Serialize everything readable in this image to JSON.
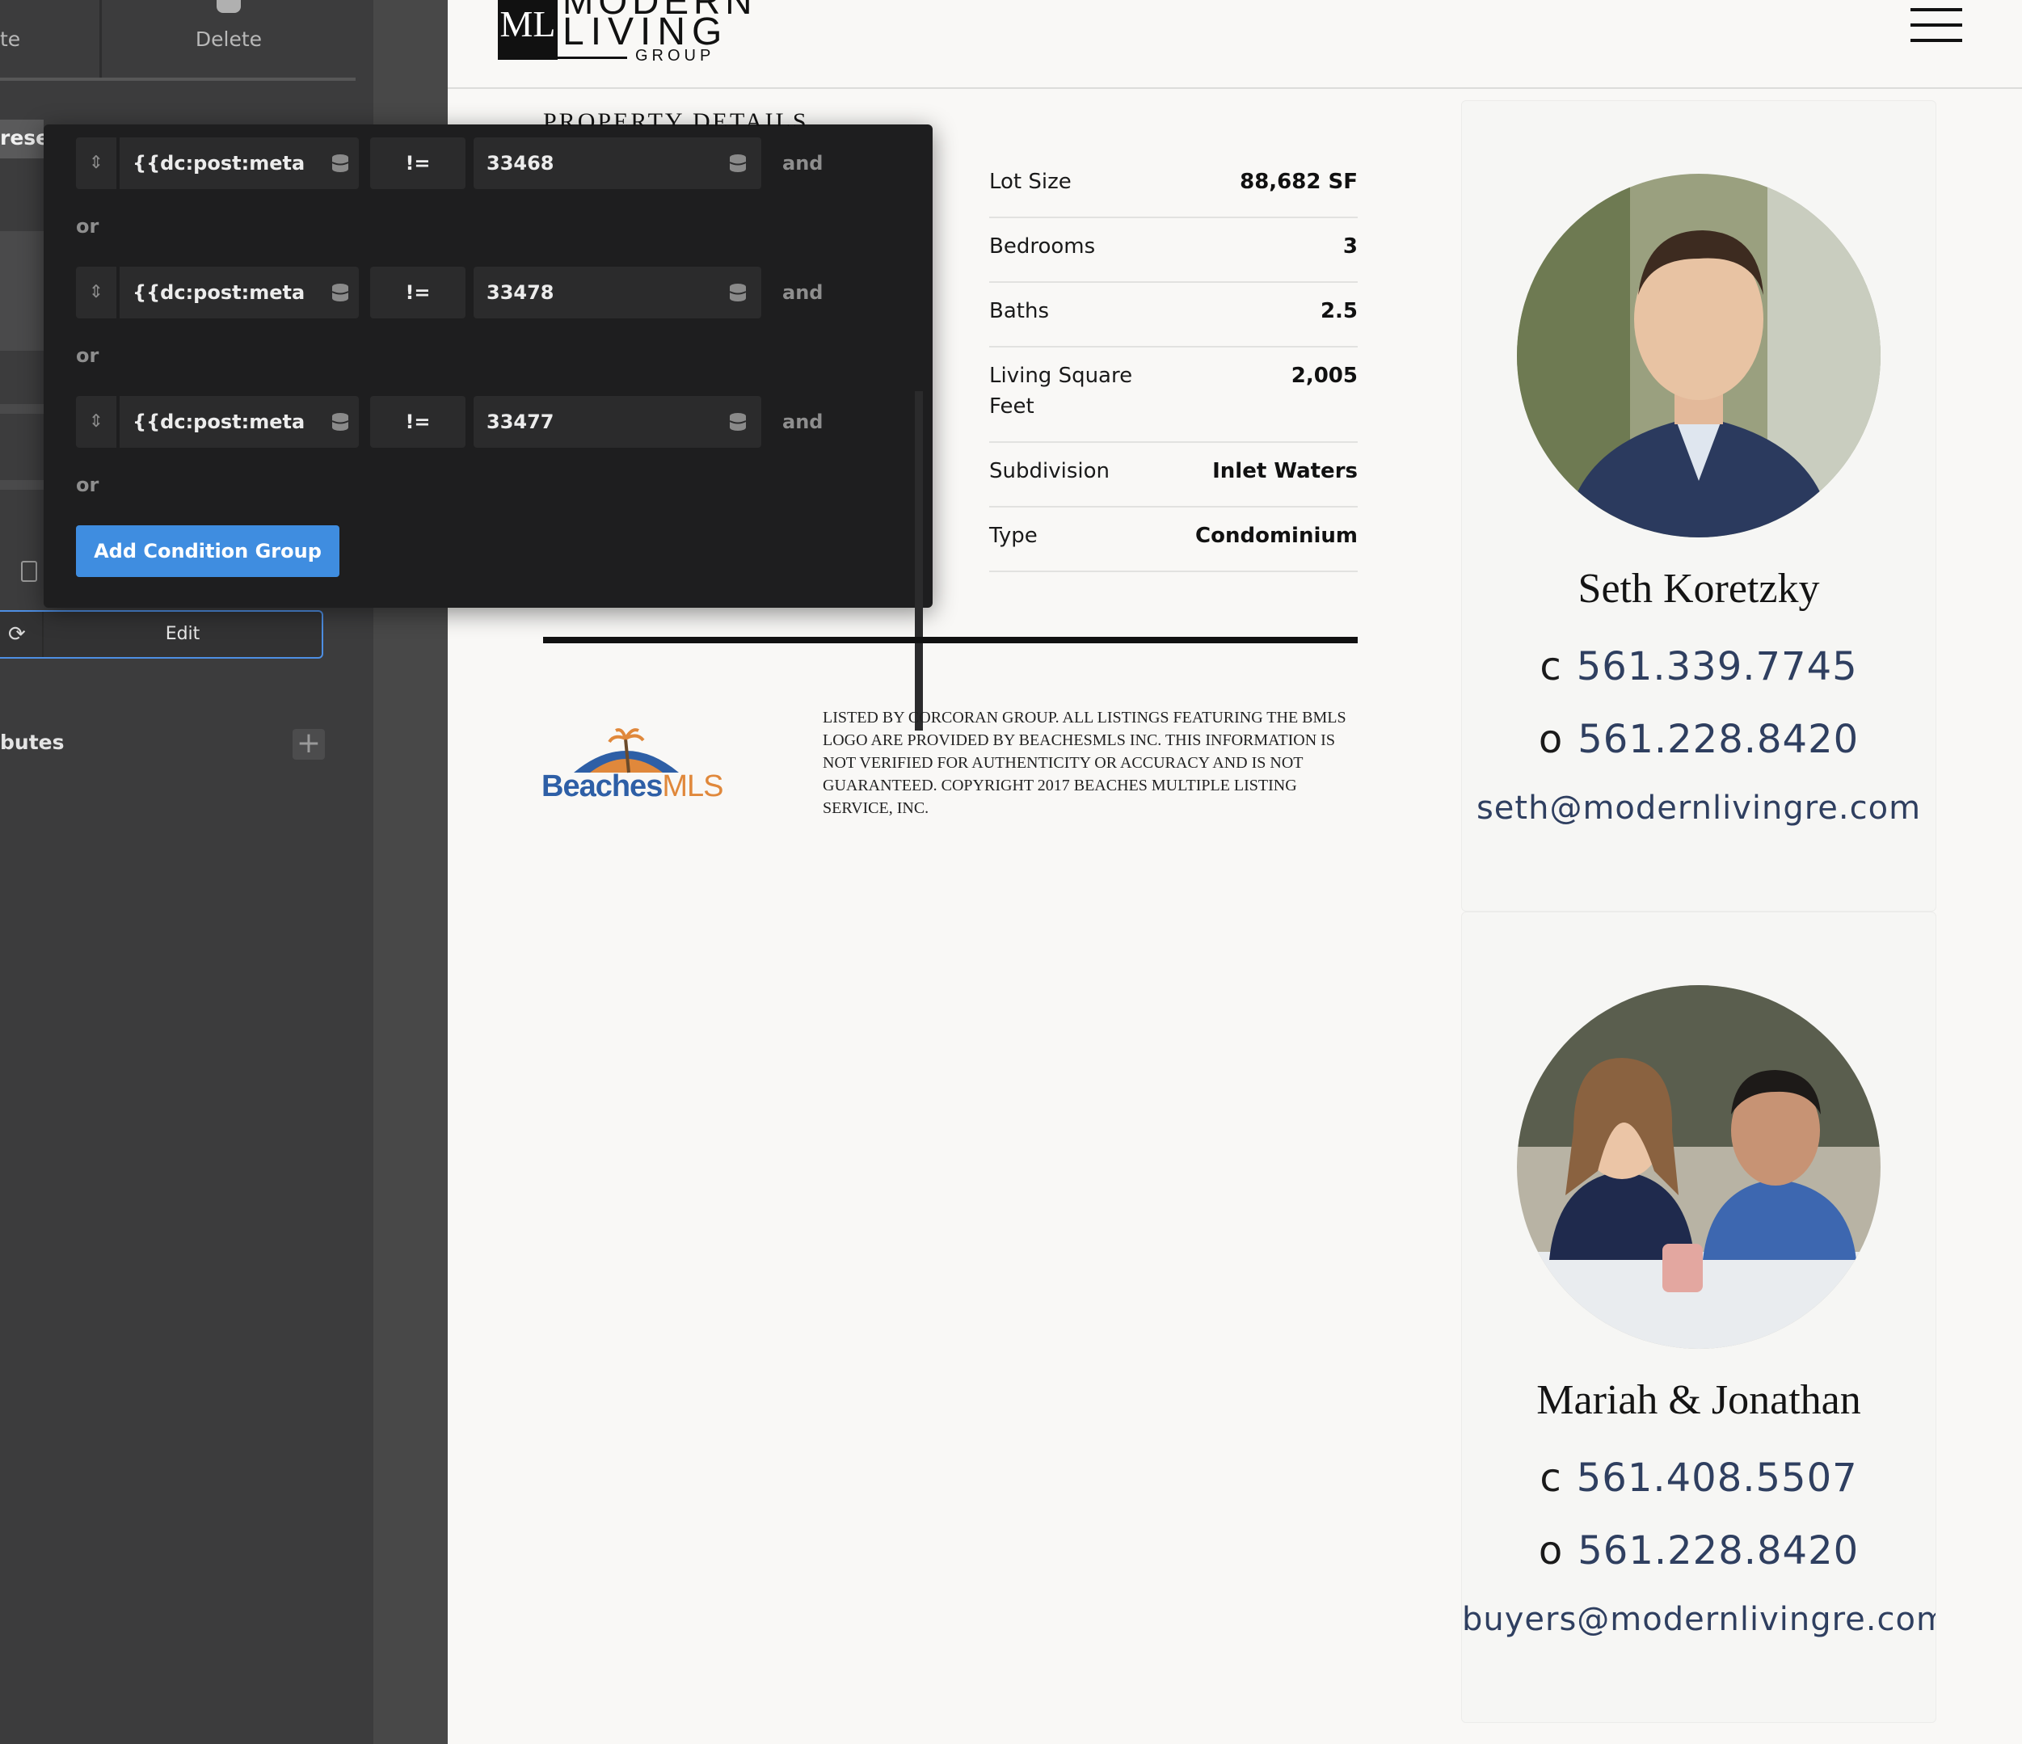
{
  "builder": {
    "left_partial_label": "te",
    "delete_label": "Delete",
    "preset_partial_label": "rese",
    "edit_label": "Edit",
    "attributes_partial_label": "butes",
    "add_icon": "plus-icon"
  },
  "conditions": {
    "rows": [
      {
        "key": "{{dc:post:meta key",
        "operator": "!=",
        "value": "33468",
        "joiner": "and"
      },
      {
        "key": "{{dc:post:meta key",
        "operator": "!=",
        "value": "33478",
        "joiner": "and"
      },
      {
        "key": "{{dc:post:meta key",
        "operator": "!=",
        "value": "33477",
        "joiner": "and"
      }
    ],
    "or_label": "or",
    "add_group_label": "Add Condition Group"
  },
  "site": {
    "logo": {
      "monogram": "ML",
      "top": "MODERN",
      "middle": "LIVING",
      "sub": "GROUP"
    },
    "menu_icon": "hamburger-icon"
  },
  "property": {
    "section_title": "PROPERTY DETAILS",
    "details": [
      {
        "label": "Lot Size",
        "value": "88,682 SF"
      },
      {
        "label": "Bedrooms",
        "value": "3"
      },
      {
        "label": "Baths",
        "value": "2.5"
      },
      {
        "label": "Living Square Feet",
        "value": "2,005"
      },
      {
        "label": "Subdivision",
        "value": "Inlet Waters"
      },
      {
        "label": "Type",
        "value": "Condominium"
      }
    ],
    "mls_logo": {
      "part1": "Beaches",
      "part2": "MLS"
    },
    "disclaimer": "LISTED BY CORCORAN GROUP. ALL LISTINGS FEATURING THE BMLS LOGO ARE PROVIDED BY BEACHESMLS INC. THIS INFORMATION IS NOT VERIFIED FOR AUTHENTICITY OR ACCURACY AND IS NOT GUARANTEED. COPYRIGHT 2017 BEACHES MULTIPLE LISTING SERVICE, INC."
  },
  "agents": [
    {
      "name": "Seth Koretzky",
      "cell_prefix": "c",
      "cell": "561.339.7745",
      "office_prefix": "o",
      "office": "561.228.8420",
      "email": "seth@modernlivingre.com"
    },
    {
      "name": "Mariah & Jonathan",
      "cell_prefix": "c",
      "cell": "561.408.5507",
      "office_prefix": "o",
      "office": "561.228.8420",
      "email": "buyers@modernlivingre.com"
    }
  ],
  "colors": {
    "accent_blue": "#3f8de0",
    "agent_text": "#2f3f60",
    "popup_bg": "#1e1e1f",
    "sidebar_bg": "#3c3c3d"
  }
}
